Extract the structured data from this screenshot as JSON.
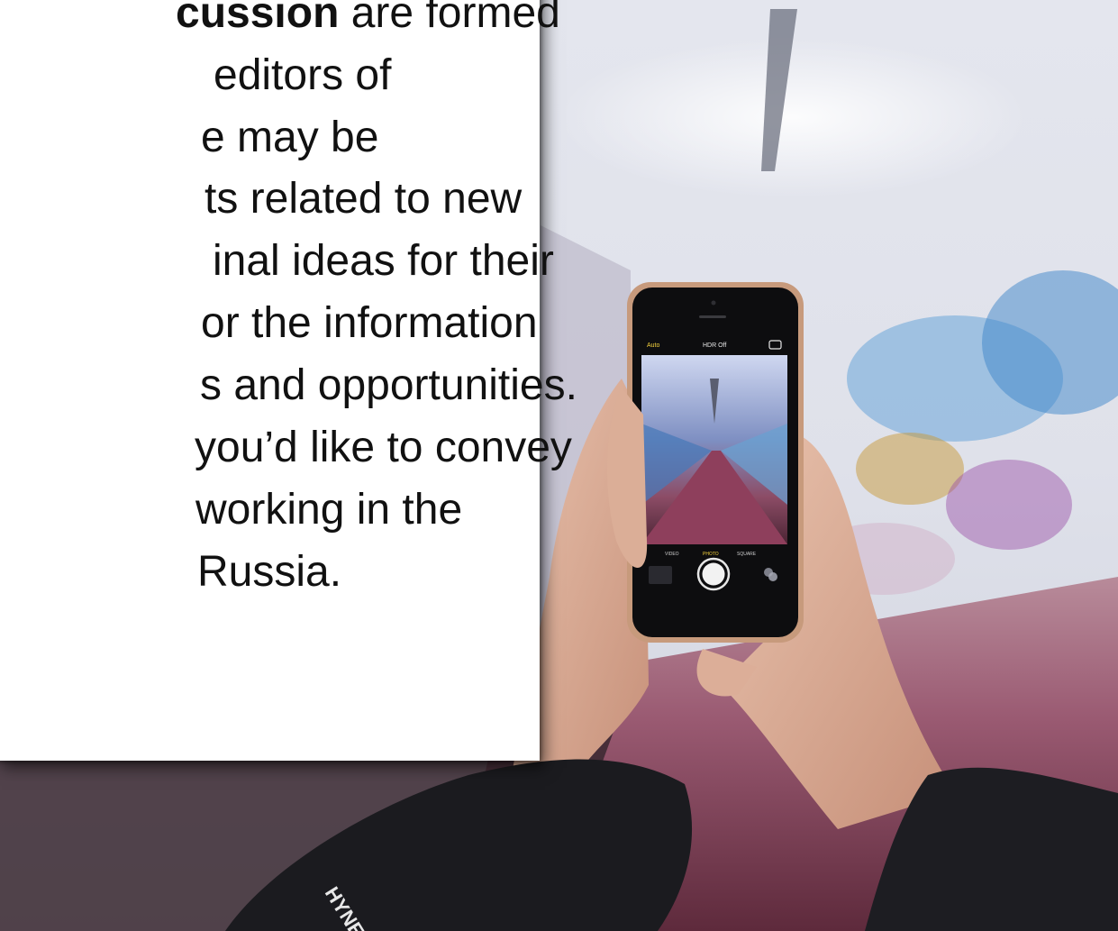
{
  "card": {
    "lines": [
      {
        "bold": "cussion",
        "rest": " are formed"
      },
      {
        "bold": "",
        "rest": "editors of"
      },
      {
        "bold": "",
        "rest": "e may be"
      },
      {
        "bold": "",
        "rest": "ts related to new"
      },
      {
        "bold": "",
        "rest": "inal ideas for their"
      },
      {
        "bold": "",
        "rest": "or the information"
      },
      {
        "bold": "",
        "rest": "s and opportunities."
      },
      {
        "bold": "",
        "rest": "you’d like to convey"
      },
      {
        "bold": "",
        "rest": "working in the"
      },
      {
        "bold": "",
        "rest": "Russia."
      }
    ]
  },
  "photo": {
    "phone_status": {
      "flash": "Auto",
      "hdr": "HDR Off"
    },
    "phone_modes": [
      "VIDEO",
      "PHOTO",
      "SQUARE"
    ],
    "sleeve_text": "HYNERZ"
  }
}
